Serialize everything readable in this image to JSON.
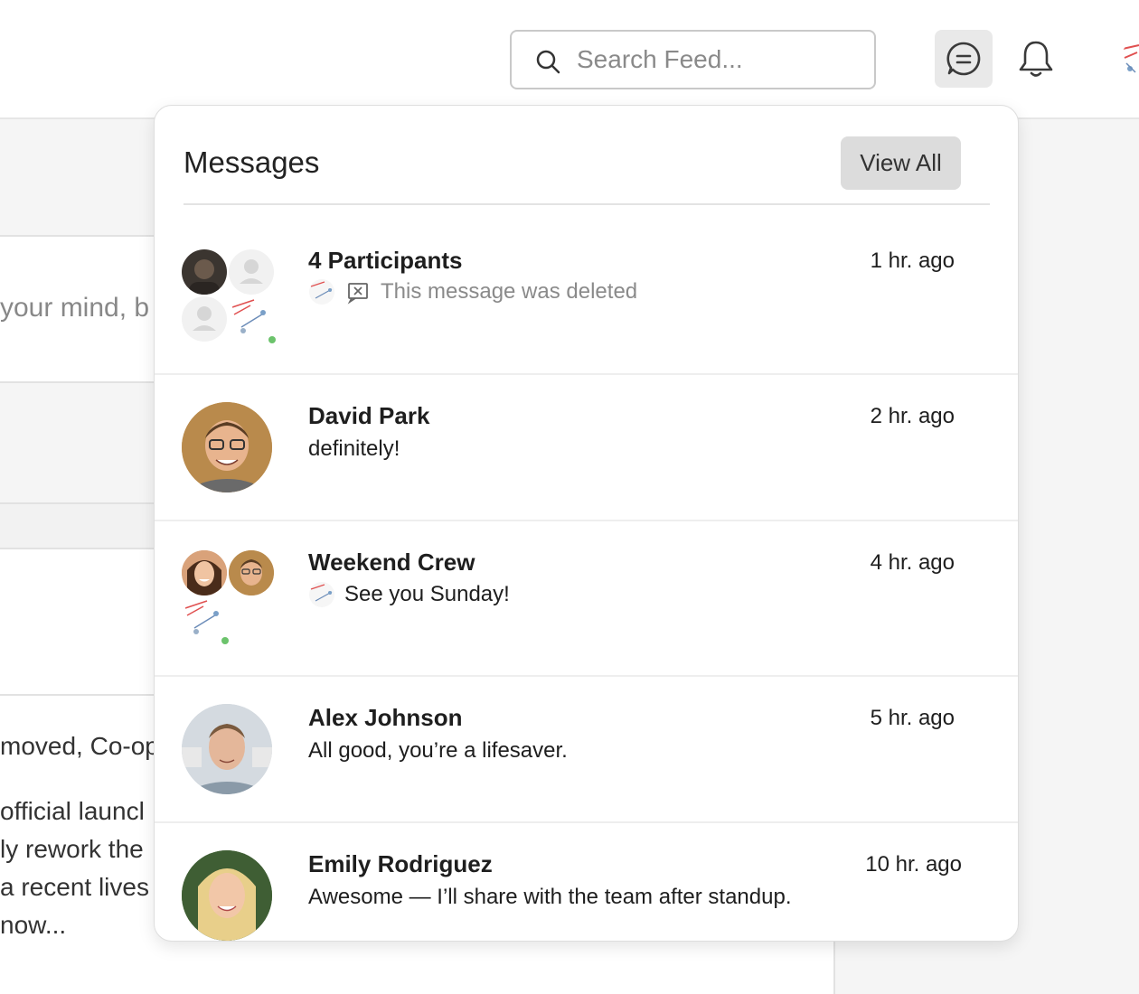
{
  "header": {
    "search_placeholder": "Search Feed...",
    "icons": [
      "search-icon",
      "chat-icon",
      "bell-icon"
    ]
  },
  "feed": {
    "composer_text": "your mind, b",
    "lines": [
      "moved, Co-op",
      "official launcl",
      "ly rework the",
      " a recent lives",
      "now..."
    ]
  },
  "messages": {
    "title": "Messages",
    "view_all_label": "View All",
    "conversations": [
      {
        "name": "4 Participants",
        "time": "1 hr. ago",
        "preview": "This message was deleted",
        "deleted": true
      },
      {
        "name": "David Park",
        "time": "2 hr. ago",
        "preview": "definitely!"
      },
      {
        "name": "Weekend Crew",
        "time": "4 hr. ago",
        "preview": "See you Sunday!"
      },
      {
        "name": "Alex Johnson",
        "time": "5 hr. ago",
        "preview": "All good, you’re a lifesaver."
      },
      {
        "name": "Emily Rodriguez",
        "time": "10 hr. ago",
        "preview": "Awesome — I’ll share with the team after standup."
      }
    ]
  },
  "colors": {
    "online": "#6cc36c",
    "view_all_bg": "#dcdcdc",
    "deleted_text": "#8a8a8a"
  }
}
